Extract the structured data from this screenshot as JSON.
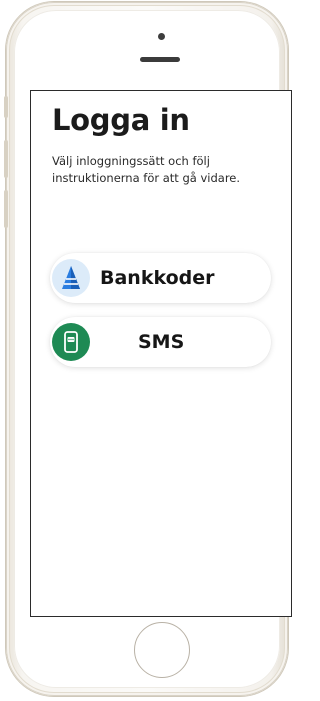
{
  "login": {
    "title": "Logga in",
    "subtitle": "Välj inloggningssätt och följ instruktionerna för att gå vidare."
  },
  "methods": [
    {
      "label": "Bankkoder",
      "icon": "bank-id-icon",
      "icon_color": "#2a7de0",
      "icon_bg": "#dcebf9"
    },
    {
      "label": "SMS",
      "icon": "sms-phone-icon",
      "icon_color": "#ffffff",
      "icon_bg": "#1e8a54"
    }
  ]
}
